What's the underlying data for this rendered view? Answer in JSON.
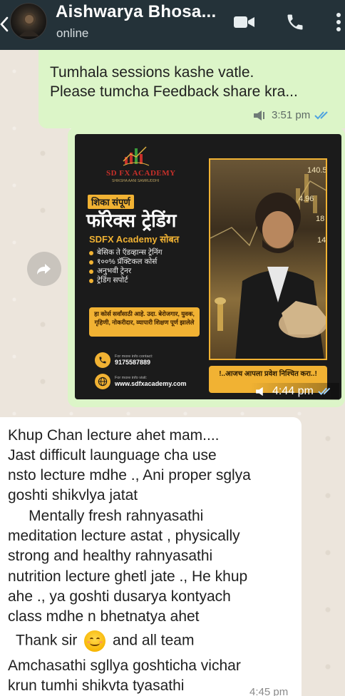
{
  "header": {
    "contact_name": "Aishwarya Bhosa...",
    "status": "online",
    "icons": [
      "back-arrow-icon",
      "video-call-icon",
      "voice-call-icon",
      "more-options-icon"
    ]
  },
  "messages": [
    {
      "direction": "outgoing",
      "text_lines": [
        "Tumhala sessions kashe vatle.",
        "Please tumcha Feedback share kra..."
      ],
      "time": "3:51 pm",
      "status_icons": [
        "volume-icon",
        "double-check-icon"
      ]
    },
    {
      "direction": "outgoing",
      "type": "image",
      "time": "4:44 pm",
      "poster": {
        "brand": "SD FX ACADEMY",
        "brand_sub": "SHIKSHA AANI SAMRUDDHI",
        "kicker": "शिका संपूर्ण",
        "headline": "फॉरेक्स ट्रेडिंग",
        "tagline": "SDFX Academy सोबत",
        "bullets": [
          "बेसिक ते ऍडव्हान्स ट्रेनिंग",
          "१००% प्रॅक्टिकल कोर्स",
          "अनुभवी ट्रेनर",
          "ट्रेडिंग सपोर्ट"
        ],
        "audience": "हा कोर्स सर्वांसाठी आहे. उदा. बेरोजगार, युवक, गृहिणी, नोकरीदार, व्यापारी शिक्षण पूर्ण झालेले",
        "contact_label": "For more info contact:",
        "phone": "9175587889",
        "visit_label": "For more info visit:",
        "website": "www.sdfxacademy.com",
        "cta": "!..आजच आपला प्रवेश निश्चित करा..!",
        "chart_numbers": [
          "140.5",
          "4.96",
          "18",
          "14"
        ]
      }
    },
    {
      "direction": "incoming",
      "lines": [
        "Khup Chan lecture ahet mam....",
        "Jast difficult launguage cha use",
        "nsto lecture mdhe ., Ani proper sglya",
        "goshti shikvlya jatat",
        "     Mentally fresh rahnyasathi",
        "meditation lecture astat , physically",
        "strong and healthy rahnyasathi",
        "nutrition lecture ghetl jate ., He khup",
        "ahe ., ya goshti dusarya kontyach",
        "class mdhe n bhetnatya ahet"
      ],
      "thank_line": {
        "before": "Thank sir",
        "after": "and all team",
        "emoji": "smiling-face-emoji"
      },
      "closing_lines": [
        "Amchasathi sgllya goshticha vichar",
        "krun tumhi shikvta tyasathi"
      ],
      "time": "4:45 pm"
    }
  ],
  "colors": {
    "header_bg": "#243239",
    "outgoing_bubble": "#dcf5c8",
    "incoming_bubble": "#ffffff",
    "read_tick": "#4fa3e0",
    "poster_gold": "#f1b233",
    "wallpaper": "#ece5dc"
  }
}
